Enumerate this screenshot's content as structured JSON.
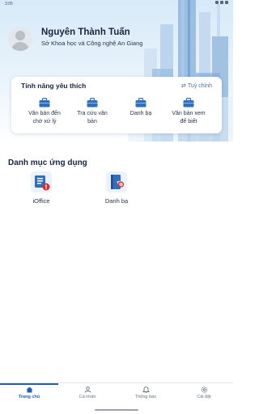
{
  "status_bar": {
    "time": "3:05"
  },
  "profile": {
    "name": "Nguyên Thành Tuấn",
    "organization": "Sở Khoa học và Công nghệ An Giang"
  },
  "favorites": {
    "title": "Tính năng yêu thích",
    "customize_label": "Tuỳ chỉnh",
    "items": [
      {
        "line1": "Văn bản đến",
        "line2": "chờ xử lý",
        "icon": "briefcase-icon"
      },
      {
        "line1": "Tra cứu văn",
        "line2": "bản",
        "icon": "briefcase-icon"
      },
      {
        "line1": "Danh bạ",
        "line2": "",
        "icon": "briefcase-icon"
      },
      {
        "line1": "Văn bản xem",
        "line2": "để biết",
        "icon": "briefcase-icon"
      }
    ]
  },
  "apps": {
    "title": "Danh mục ứng dụng",
    "items": [
      {
        "label": "iOffice",
        "icon": "ioffice-icon"
      },
      {
        "label": "Danh bạ",
        "icon": "contacts-book-icon"
      }
    ]
  },
  "bottom_nav": {
    "items": [
      {
        "label": "Trang chủ",
        "icon": "home-icon",
        "active": true
      },
      {
        "label": "Cá nhân",
        "icon": "person-icon",
        "active": false
      },
      {
        "label": "Thông báo",
        "icon": "bell-icon",
        "active": false
      },
      {
        "label": "Cài đặt",
        "icon": "gear-icon",
        "active": false
      }
    ]
  },
  "colors": {
    "accent": "#1e5fb8",
    "icon_blue": "#2f6fbe",
    "alert_red": "#d93025"
  }
}
